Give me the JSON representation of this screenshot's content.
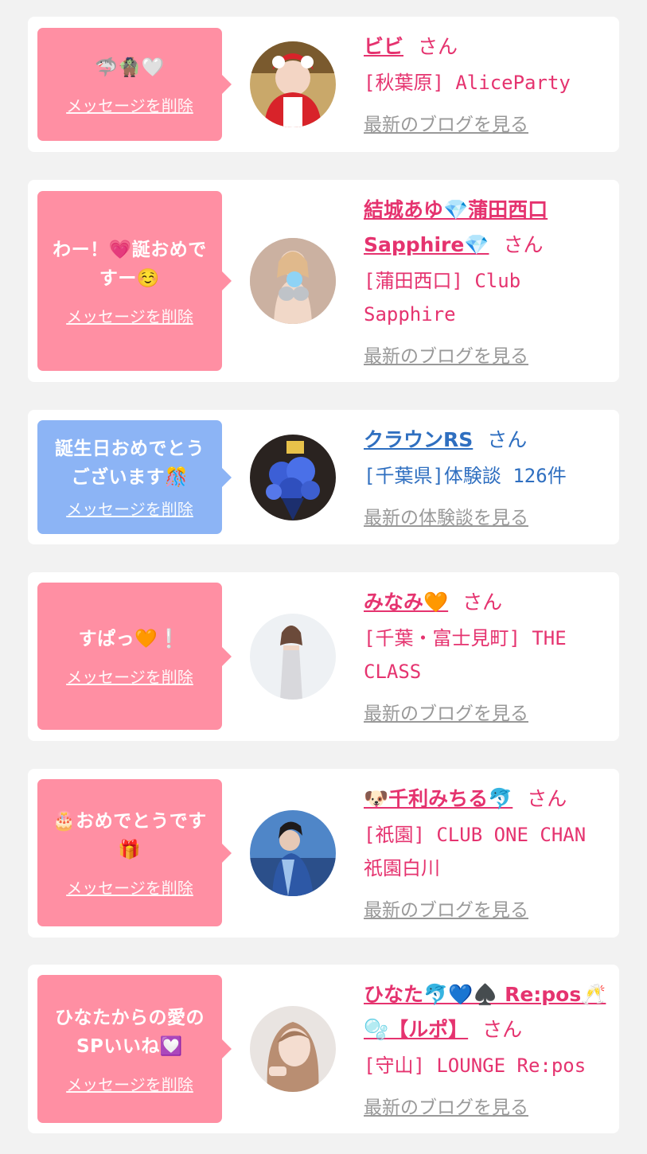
{
  "cards": [
    {
      "message": "🦈🧌🤍",
      "delete_label": "メッセージを削除",
      "name": "ビビ",
      "suffix": "さん",
      "shop": "[秋葉原] AliceParty",
      "link_label": "最新のブログを見る",
      "theme": "pink",
      "avatar_icon": "cast-photo-avatar"
    },
    {
      "message": "わー！💗誕おめですー☺️",
      "delete_label": "メッセージを削除",
      "name": "結城あゆ💎蒲田西口Sapphire💎",
      "suffix": "さん",
      "shop": "[蒲田西口] Club Sapphire",
      "link_label": "最新のブログを見る",
      "theme": "pink",
      "avatar_icon": "cast-photo-avatar"
    },
    {
      "message": "誕生日おめでとうございます🎊",
      "delete_label": "メッセージを削除",
      "name": "クラウンRS",
      "suffix": "さん",
      "shop": "[千葉県]体験談 126件",
      "link_label": "最新の体験談を見る",
      "theme": "blue",
      "avatar_icon": "flower-bouquet-avatar"
    },
    {
      "message": "すぱっ🧡❕",
      "delete_label": "メッセージを削除",
      "name": "みなみ🧡",
      "suffix": "さん",
      "shop": "[千葉・富士見町] THE CLASS",
      "link_label": "最新のブログを見る",
      "theme": "pink",
      "avatar_icon": "cast-photo-avatar"
    },
    {
      "message": "🎂おめでとうです🎁",
      "delete_label": "メッセージを削除",
      "name": "🐶千利みちる🐬",
      "suffix": "さん",
      "shop": "[祇園] CLUB ONE CHAN 祇園白川",
      "link_label": "最新のブログを見る",
      "theme": "pink",
      "avatar_icon": "cast-photo-avatar"
    },
    {
      "message": "ひなたからの愛のSPいいね💟",
      "delete_label": "メッセージを削除",
      "name": "ひなた🐬💙♠️ Re:pos🥂🫧【ルポ】",
      "suffix": "さん",
      "shop": "[守山] LOUNGE Re:pos",
      "link_label": "最新のブログを見る",
      "theme": "pink",
      "avatar_icon": "cast-photo-avatar"
    }
  ],
  "colors": {
    "pink_bubble": "#ff8fa3",
    "blue_bubble": "#8cb4f5",
    "pink_text": "#e5336f",
    "blue_text": "#2f6fc0",
    "link_gray": "#999999",
    "background": "#f2f2f2"
  }
}
